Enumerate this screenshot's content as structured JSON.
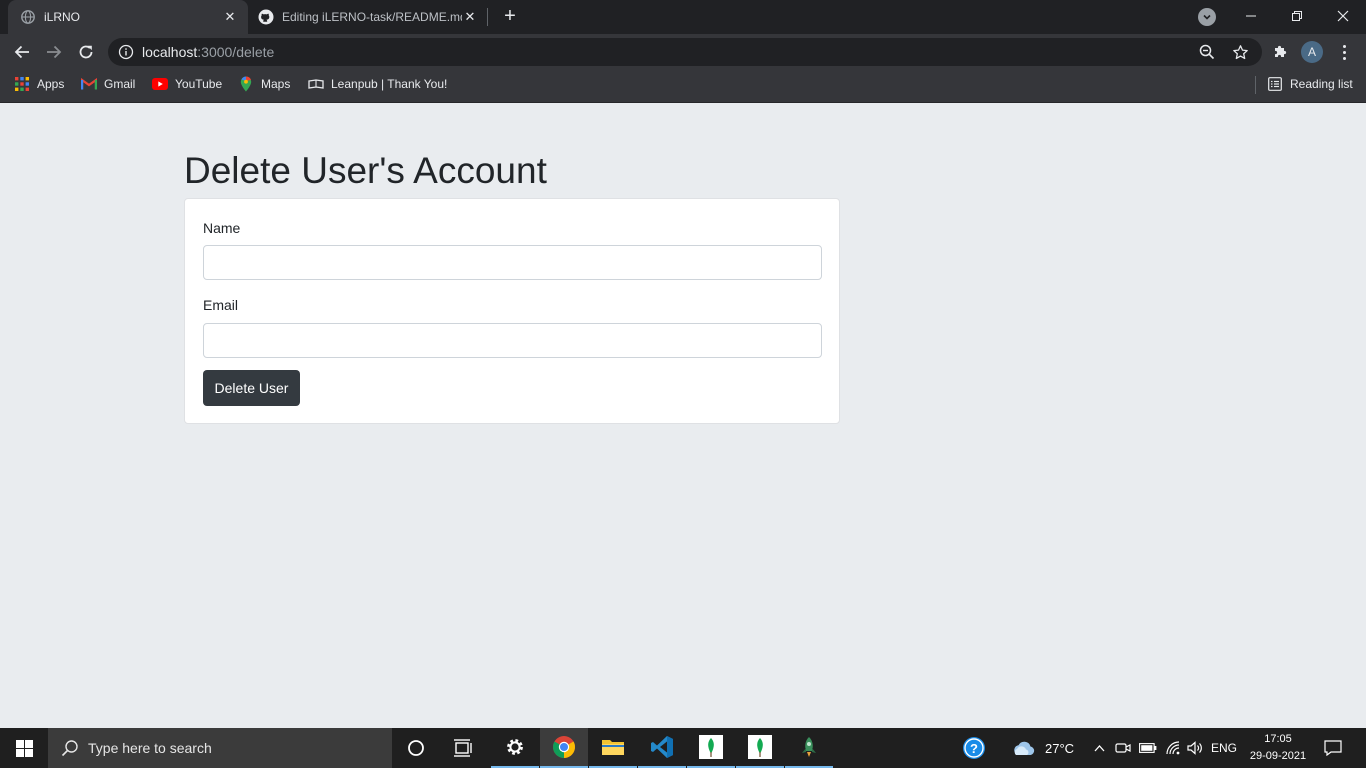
{
  "browser": {
    "tabs": [
      {
        "title": "iLRNO",
        "active": true
      },
      {
        "title": "Editing iLERNO-task/README.md",
        "active": false
      }
    ],
    "address": {
      "host": "localhost",
      "path": ":3000/delete"
    },
    "bookmarks": [
      {
        "label": "Apps",
        "icon": "apps-grid-icon"
      },
      {
        "label": "Gmail",
        "icon": "gmail-icon"
      },
      {
        "label": "YouTube",
        "icon": "youtube-icon"
      },
      {
        "label": "Maps",
        "icon": "maps-icon"
      },
      {
        "label": "Leanpub | Thank You!",
        "icon": "leanpub-icon"
      }
    ],
    "reading_list": "Reading list",
    "profile_initial": "A"
  },
  "page": {
    "heading": "Delete User's Account",
    "form": {
      "name_label": "Name",
      "name_value": "",
      "email_label": "Email",
      "email_value": "",
      "submit_label": "Delete User"
    }
  },
  "taskbar": {
    "search_placeholder": "Type here to search",
    "weather": "27°C",
    "language": "ENG",
    "time": "17:05",
    "date": "29-09-2021"
  },
  "colors": {
    "page_background": "#e9ecef",
    "button_background": "#343a40",
    "chrome_dark": "#202124",
    "chrome_toolbar": "#35363a"
  }
}
